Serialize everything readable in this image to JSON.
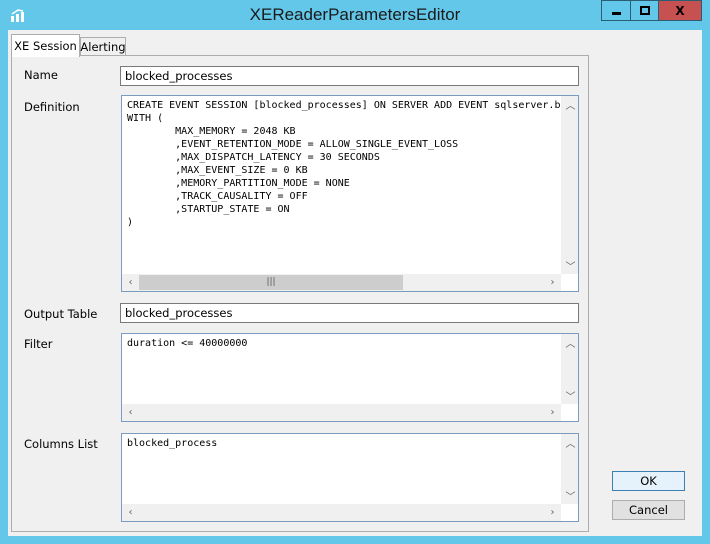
{
  "window": {
    "title": "XEReaderParametersEditor",
    "minimize": "▬",
    "maximize": "□",
    "close": "X"
  },
  "tabs": [
    {
      "label": "XE Session",
      "active": true
    },
    {
      "label": "Alerting",
      "active": false
    }
  ],
  "form": {
    "name": {
      "label": "Name",
      "value": "blocked_processes"
    },
    "definition": {
      "label": "Definition",
      "value": "CREATE EVENT SESSION [blocked_processes] ON SERVER ADD EVENT sqlserver.b\nWITH (\n        MAX_MEMORY = 2048 KB\n        ,EVENT_RETENTION_MODE = ALLOW_SINGLE_EVENT_LOSS\n        ,MAX_DISPATCH_LATENCY = 30 SECONDS\n        ,MAX_EVENT_SIZE = 0 KB\n        ,MEMORY_PARTITION_MODE = NONE\n        ,TRACK_CAUSALITY = OFF\n        ,STARTUP_STATE = ON\n)"
    },
    "output_table": {
      "label": "Output Table",
      "value": "blocked_processes"
    },
    "filter": {
      "label": "Filter",
      "value": "duration <= 40000000"
    },
    "columns_list": {
      "label": "Columns List",
      "value": "blocked_process"
    }
  },
  "buttons": {
    "ok": "OK",
    "cancel": "Cancel"
  }
}
